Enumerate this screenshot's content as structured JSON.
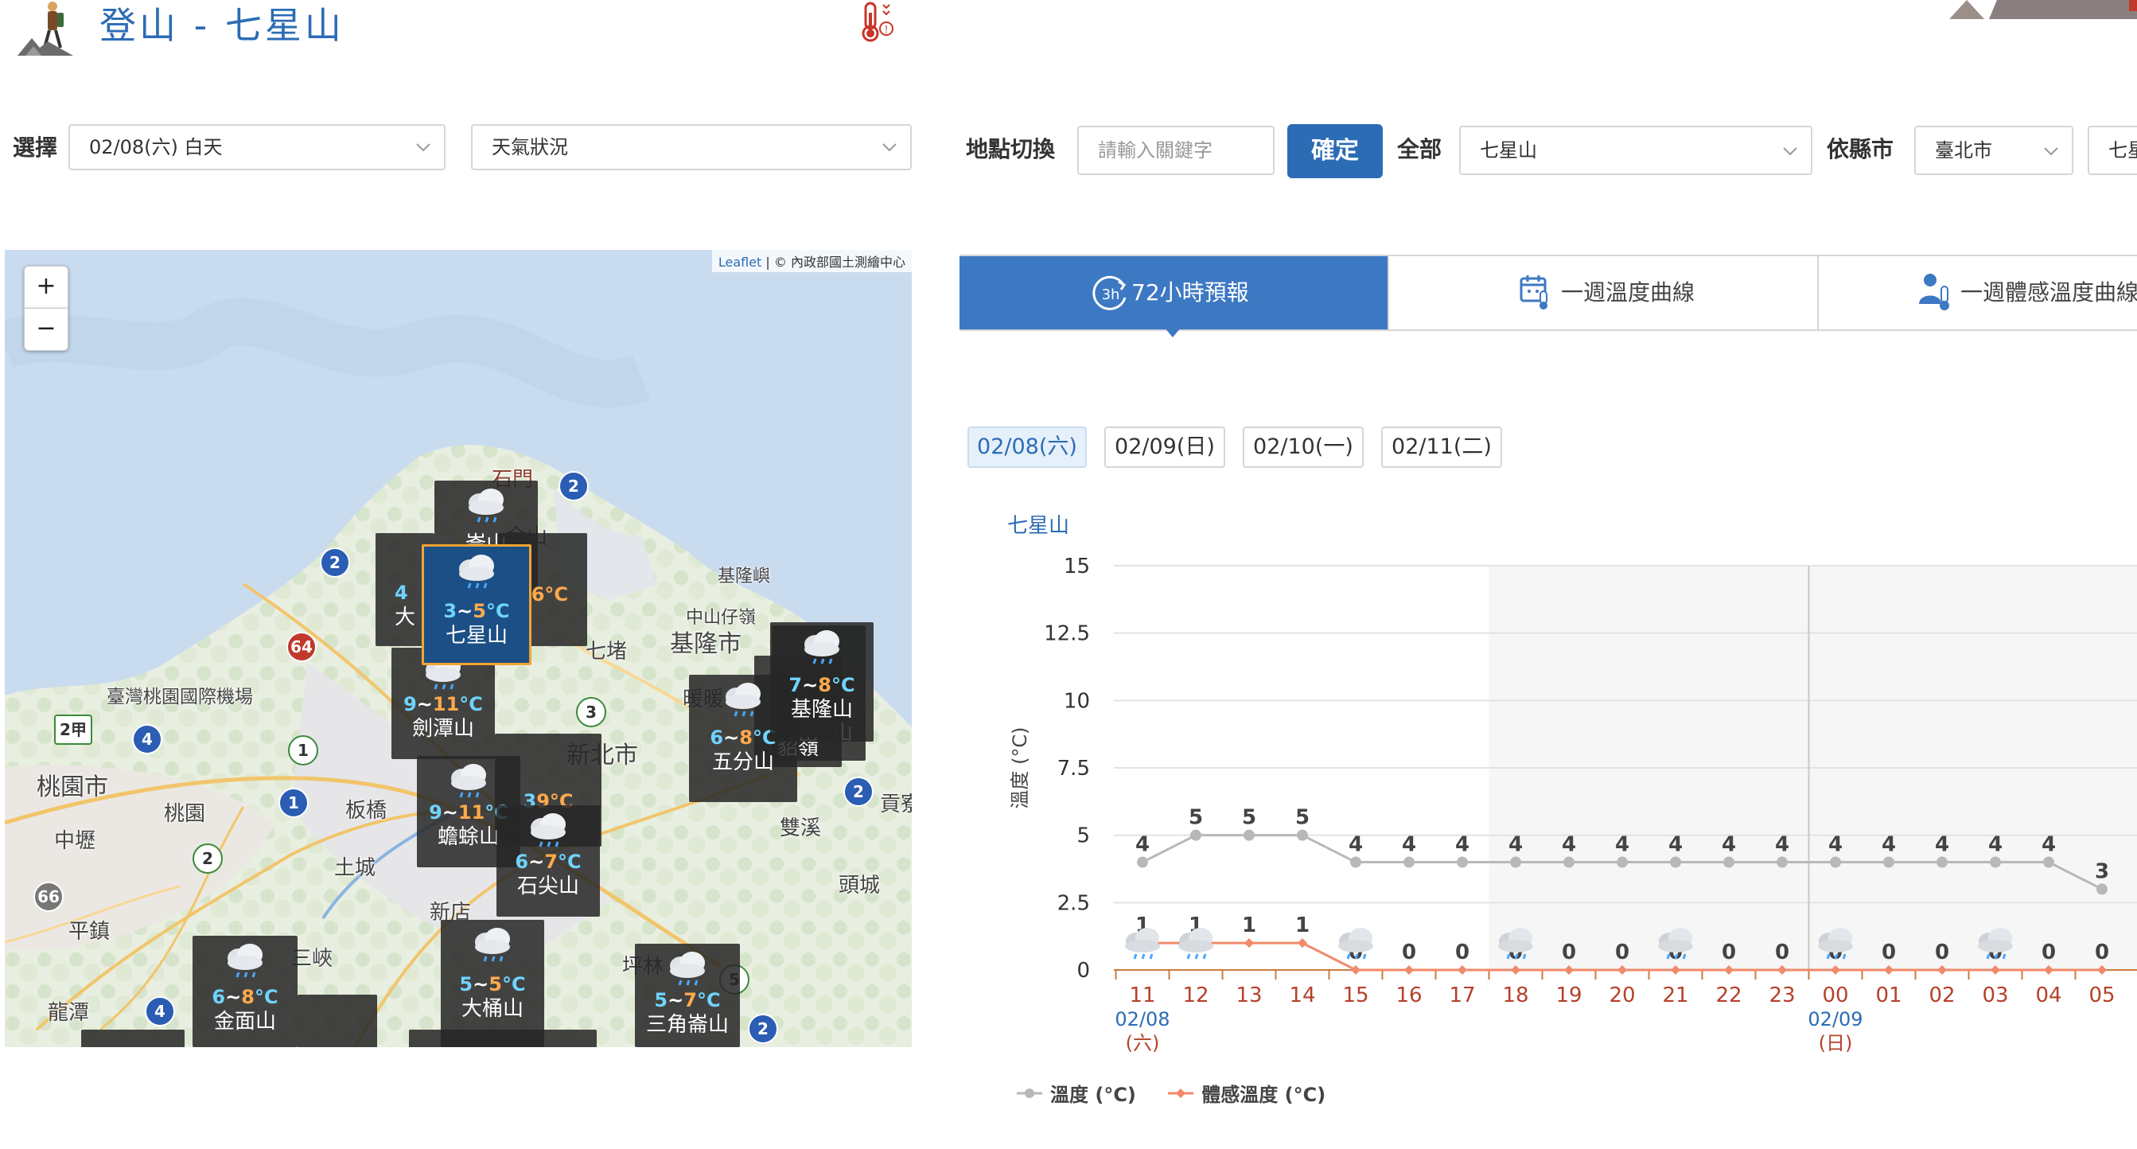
{
  "header": {
    "title": "登山 - 七星山"
  },
  "filters": {
    "select_label": "選擇",
    "date_select": "02/08(六) 白天",
    "layer_select": "天氣狀況"
  },
  "location": {
    "label": "地點切換",
    "search_placeholder": "請輸入關鍵字",
    "confirm_button": "確定",
    "all_label": "全部",
    "mountain_select": "七星山",
    "county_label": "依縣市",
    "county_select": "臺北市",
    "county_mountain_select": "七星"
  },
  "map": {
    "zoom_in": "+",
    "zoom_out": "−",
    "attribution_link": "Leaflet",
    "attribution_text": "| © 內政部國土測繪中心",
    "places": [
      "石門",
      "金山",
      "基隆嶼",
      "中山仔嶺",
      "基隆市",
      "七堵",
      "新北市",
      "臺灣桃園國際機場",
      "桃園市",
      "桃園",
      "中壢",
      "板橋",
      "土城",
      "新店",
      "三峽",
      "平鎮",
      "龍潭",
      "坪林",
      "雙溪",
      "頭城",
      "貢寮",
      "暖暖"
    ],
    "road_shields": [
      "2",
      "2",
      "64",
      "3",
      "2甲",
      "4",
      "1",
      "1",
      "2",
      "66",
      "4",
      "5",
      "2",
      "2"
    ],
    "markers": [
      {
        "temp_low": "3",
        "temp_high": "5",
        "unit": "°C",
        "name": "七星山"
      },
      {
        "temp_low": "9",
        "temp_high": "11",
        "unit": "°C",
        "name": "劍潭山"
      },
      {
        "temp_low": "9",
        "temp_high": "11",
        "unit": "°C",
        "name": "蟾蜍山"
      },
      {
        "temp_low": "6",
        "temp_high": "7",
        "unit": "°C",
        "name": "石尖山"
      },
      {
        "temp_low": "7",
        "temp_high": "8",
        "unit": "°C",
        "name": "基隆山"
      },
      {
        "temp_low": "6",
        "temp_high": "8",
        "unit": "°C",
        "name": "五分山"
      },
      {
        "temp_low": "5",
        "temp_high": "5",
        "unit": "°C",
        "name": "大桶山"
      },
      {
        "temp_low": "6",
        "temp_high": "8",
        "unit": "°C",
        "name": "金面山"
      },
      {
        "temp_low": "5",
        "temp_high": "7",
        "unit": "°C",
        "name": "三角崙山"
      },
      {
        "fragment_a": "6°C",
        "fragment_b": "大",
        "fragment_c": "4",
        "fragment_d": "崙山"
      },
      {
        "fragment_a": "3",
        "fragment_b": "9°C",
        "fragment_c": "山"
      },
      {
        "fragment_a": "貂嶺",
        "fragment_b": "山"
      }
    ]
  },
  "tabs": [
    {
      "label": "72小時預報",
      "icon_text": "3h",
      "active": true
    },
    {
      "label": "一週溫度曲線",
      "active": false
    },
    {
      "label": "一週體感溫度曲線",
      "active": false
    }
  ],
  "day_buttons": [
    {
      "label": "02/08(六)",
      "active": true
    },
    {
      "label": "02/09(日)",
      "active": false
    },
    {
      "label": "02/10(一)",
      "active": false
    },
    {
      "label": "02/11(二)",
      "active": false
    }
  ],
  "chart_data": {
    "type": "line",
    "title": "七星山",
    "ylabel": "溫度 (°C)",
    "ylim": [
      0,
      15
    ],
    "yticks": [
      "0",
      "2.5",
      "5",
      "7.5",
      "10",
      "12.5",
      "15"
    ],
    "x": [
      "11",
      "12",
      "13",
      "14",
      "15",
      "16",
      "17",
      "18",
      "19",
      "20",
      "21",
      "22",
      "23",
      "00",
      "01",
      "02",
      "03",
      "04",
      "05"
    ],
    "date_labels": [
      {
        "at": "11",
        "date": "02/08",
        "weekday": "(六)"
      },
      {
        "at": "00",
        "date": "02/09",
        "weekday": "(日)"
      }
    ],
    "series": [
      {
        "name": "溫度 (°C)",
        "color": "#b8b8b8",
        "values": [
          4,
          5,
          5,
          5,
          4,
          4,
          4,
          4,
          4,
          4,
          4,
          4,
          4,
          4,
          4,
          4,
          4,
          4,
          3
        ]
      },
      {
        "name": "體感溫度 (°C)",
        "color": "#f08a6a",
        "values": [
          1,
          1,
          1,
          1,
          0,
          0,
          0,
          0,
          0,
          0,
          0,
          0,
          0,
          0,
          0,
          0,
          0,
          0,
          0
        ]
      }
    ],
    "weather_icons_at": [
      "11",
      "12",
      "15",
      "18",
      "21",
      "00",
      "03"
    ],
    "night_shading": [
      "18",
      "05"
    ],
    "grid": true,
    "legend": "bottom-left"
  }
}
